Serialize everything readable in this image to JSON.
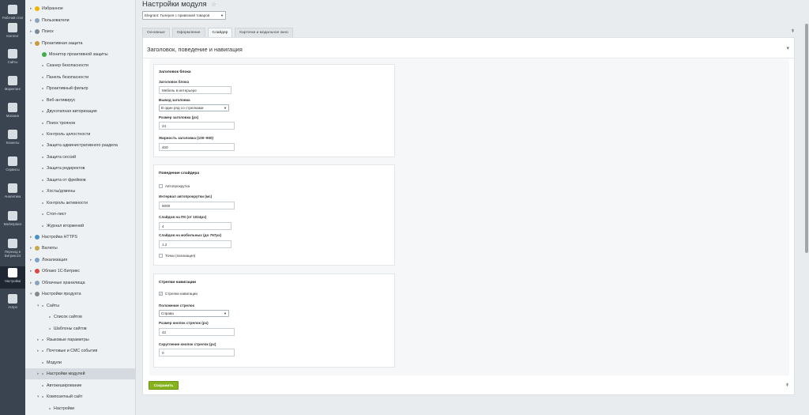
{
  "rail": [
    {
      "label": "Рабочий стол",
      "icon": "desktop-icon"
    },
    {
      "label": "Контент",
      "icon": "document-icon"
    },
    {
      "label": "Сайты",
      "icon": "calendar-24-icon"
    },
    {
      "label": "Маркетинг",
      "icon": "target-icon"
    },
    {
      "label": "Магазин",
      "icon": "shop-icon"
    },
    {
      "label": "Клиенты",
      "icon": "clients-icon"
    },
    {
      "label": "Сервисы",
      "icon": "layers-icon"
    },
    {
      "label": "Аналитика",
      "icon": "chart-icon"
    },
    {
      "label": "Marketplace",
      "icon": "cloud-icon"
    },
    {
      "label": "Переход в Битрикс24",
      "icon": "bitrix24-icon"
    },
    {
      "label": "Настройки",
      "icon": "gear-icon"
    },
    {
      "label": "Аспро",
      "icon": "aspro-icon"
    }
  ],
  "tree": [
    {
      "label": "Избранное",
      "level": 0,
      "arrow": true,
      "icon": "star"
    },
    {
      "label": "Пользователи",
      "level": 0,
      "arrow": true,
      "icon": "folder"
    },
    {
      "label": "Поиск",
      "level": 0,
      "arrow": true,
      "icon": "search"
    },
    {
      "label": "Проактивная защита",
      "level": 0,
      "arrow": true,
      "icon": "shield",
      "expanded": true
    },
    {
      "label": "Монитор проактивной защиты",
      "level": 1,
      "icon": "monitor"
    },
    {
      "label": "Сканер безопасности",
      "level": 1
    },
    {
      "label": "Панель безопасности",
      "level": 1
    },
    {
      "label": "Проактивный фильтр",
      "level": 1
    },
    {
      "label": "Веб-антивирус",
      "level": 1
    },
    {
      "label": "Двухэтапная авторизация",
      "level": 1
    },
    {
      "label": "Поиск троянов",
      "level": 1
    },
    {
      "label": "Контроль целостности",
      "level": 1
    },
    {
      "label": "Защита административного раздела",
      "level": 1
    },
    {
      "label": "Защита сессий",
      "level": 1
    },
    {
      "label": "Защита редиректов",
      "level": 1
    },
    {
      "label": "Защита от фреймов",
      "level": 1
    },
    {
      "label": "Хосты/домены",
      "level": 1
    },
    {
      "label": "Контроль активности",
      "level": 1
    },
    {
      "label": "Стоп-лист",
      "level": 1
    },
    {
      "label": "Журнал вторжений",
      "level": 1
    },
    {
      "label": "Настройка HTTPS",
      "level": 0,
      "arrow": true,
      "icon": "https"
    },
    {
      "label": "Валюты",
      "level": 0,
      "arrow": true,
      "icon": "currency"
    },
    {
      "label": "Локализация",
      "level": 0,
      "arrow": true,
      "icon": "locale"
    },
    {
      "label": "Облако 1С-Битрикс",
      "level": 0,
      "arrow": true,
      "icon": "cloud"
    },
    {
      "label": "Облачные хранилища",
      "level": 0,
      "arrow": true,
      "icon": "storage"
    },
    {
      "label": "Настройки продукта",
      "level": 0,
      "arrow": true,
      "icon": "gear",
      "expanded": true
    },
    {
      "label": "Сайты",
      "level": 1,
      "arrow": true,
      "expanded": true
    },
    {
      "label": "Список сайтов",
      "level": 2
    },
    {
      "label": "Шаблоны сайтов",
      "level": 2
    },
    {
      "label": "Языковые параметры",
      "level": 1,
      "arrow": true
    },
    {
      "label": "Почтовые и СМС события",
      "level": 1,
      "arrow": true
    },
    {
      "label": "Модули",
      "level": 1
    },
    {
      "label": "Настройки модулей",
      "level": 1,
      "arrow": true,
      "active": true
    },
    {
      "label": "Автокеширование",
      "level": 1
    },
    {
      "label": "Композитный сайт",
      "level": 1,
      "arrow": true,
      "expanded": true
    },
    {
      "label": "Настройки",
      "level": 2
    }
  ],
  "header": {
    "title": "Настройки модуля",
    "module_selected": "Elegrant: Галерея с привязкой товаров"
  },
  "tabs": [
    "Основные",
    "Оформление",
    "Слайдер",
    "Карточки и модальное окно"
  ],
  "active_tab": 2,
  "section_title": "Заголовок, поведение и навигация",
  "cards": {
    "heading": {
      "title": "Заголовок блока",
      "title_label": "Заголовок блока",
      "title_value": "Мебель в интерьере",
      "output_label": "Вывод заголовка",
      "output_value": "В один ряд со стрелками",
      "size_label": "Размер заголовка (px)",
      "size_value": "24",
      "weight_label": "Жирность заголовка (100–900)",
      "weight_value": "400"
    },
    "behavior": {
      "title": "Поведение слайдера",
      "autoplay_label": "Автопрокрутка",
      "autoplay_checked": false,
      "interval_label": "Интервал автопрокрутки (мс)",
      "interval_value": "5000",
      "pc_label": "Слайдов на ПК (от 1024px)",
      "pc_value": "4",
      "mobile_label": "Слайдов на мобильных (до 767px)",
      "mobile_value": "1.2",
      "dots_label": "Точки (пагинация)",
      "dots_checked": false
    },
    "navigation": {
      "title": "Стрелки навигации",
      "arrows_label": "Стрелки навигации",
      "arrows_checked": true,
      "position_label": "Положение стрелок",
      "position_value": "Справа",
      "btn_size_label": "Размер кнопок стрелок (px)",
      "btn_size_value": "42",
      "radius_label": "Скругление кнопок стрелок (px)",
      "radius_value": "0"
    }
  },
  "save_label": "Сохранить",
  "colors": {
    "accent_green": "#86b21c",
    "rail_bg": "#3a4451"
  }
}
